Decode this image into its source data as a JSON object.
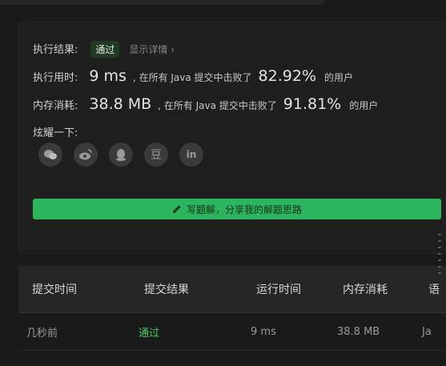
{
  "result": {
    "label": "执行结果:",
    "status": "通过",
    "detail_link": "显示详情 ›"
  },
  "runtime": {
    "label": "执行用时:",
    "value": "9 ms",
    "beat_text": ", 在所有 Java 提交中击败了",
    "percent": "82.92%",
    "suffix": "的用户"
  },
  "memory": {
    "label": "内存消耗:",
    "value": "38.8 MB",
    "beat_text": ", 在所有 Java 提交中击败了",
    "percent": "91.81%",
    "suffix": "的用户"
  },
  "share": {
    "label": "炫耀一下:",
    "icons": [
      "wechat-icon",
      "weibo-icon",
      "qq-icon",
      "douban-icon",
      "linkedin-icon"
    ],
    "douban_glyph": "豆",
    "linkedin_glyph": "in"
  },
  "solution_button": "写题解，分享我的解题思路",
  "submissions": {
    "headers": [
      "提交时间",
      "提交结果",
      "运行时间",
      "内存消耗",
      "语"
    ],
    "rows": [
      {
        "time": "几秒前",
        "result": "通过",
        "runtime": "9 ms",
        "memory": "38.8 MB",
        "lang": "Ja"
      }
    ]
  },
  "colors": {
    "accent": "#2db55d",
    "pass": "#4cc95f",
    "bg": "#1a1a1a"
  }
}
